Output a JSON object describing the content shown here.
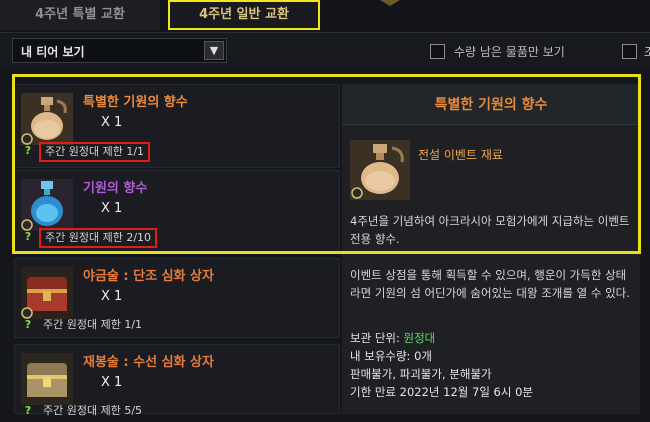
{
  "tabs": [
    {
      "label": "4주년 특별 교환",
      "active": false
    },
    {
      "label": "4주년 일반 교환",
      "active": true
    }
  ],
  "filter": {
    "tier_label": "내 티어 보기",
    "remaining_only_label": "수량 남은 물품만 보기",
    "second_checkbox_label": "조"
  },
  "items": [
    {
      "name": "특별한 기원의 향수",
      "qty": "X 1",
      "limit": "주간 원정대 제한 1/1",
      "name_color": "#ec8b3b",
      "highlighted": true,
      "icon": "perfume-bottle-icon"
    },
    {
      "name": "기원의 향수",
      "qty": "X 1",
      "limit": "주간 원정대 제한 2/10",
      "name_color": "#b35ad8",
      "highlighted": true,
      "icon": "blue-perfume-bottle-icon"
    },
    {
      "name": "야금술 : 단조 심화 상자",
      "qty": "X 1",
      "limit": "주간 원정대 제한 1/1",
      "name_color": "#e87a3a",
      "highlighted": false,
      "icon": "red-chest-icon"
    },
    {
      "name": "재봉술 : 수선 심화 상자",
      "qty": "X 1",
      "limit": "주간 원정대 제한 5/5",
      "name_color": "#e87a3a",
      "highlighted": false,
      "icon": "gold-chest-icon"
    }
  ],
  "detail": {
    "title": "특별한 기원의 향수",
    "category": "전설 이벤트 재료",
    "desc1": "4주년을 기념하여 아크라시아 모험가에게 지급하는 이벤트 전용 향수.",
    "desc2": "이벤트 상점을 통해 획득할 수 있으며, 행운이 가득한 상태라면 기원의 섬 어딘가에 숨어있는 대왕 조개를 열 수 있다.",
    "storage_label": "보관 단위: ",
    "storage_value": "원정대",
    "owned_label": "내 보유수량: ",
    "owned_value": "0개",
    "restrictions": [
      "판매불가",
      "파괴불가",
      "분해불가"
    ],
    "expiry": "기한 만료 2022년 12월 7일 6시 0분"
  },
  "colors": {
    "highlight_yellow": "#e9e019",
    "limit_red": "#e31b1b",
    "title_orange": "#e88a3a"
  }
}
